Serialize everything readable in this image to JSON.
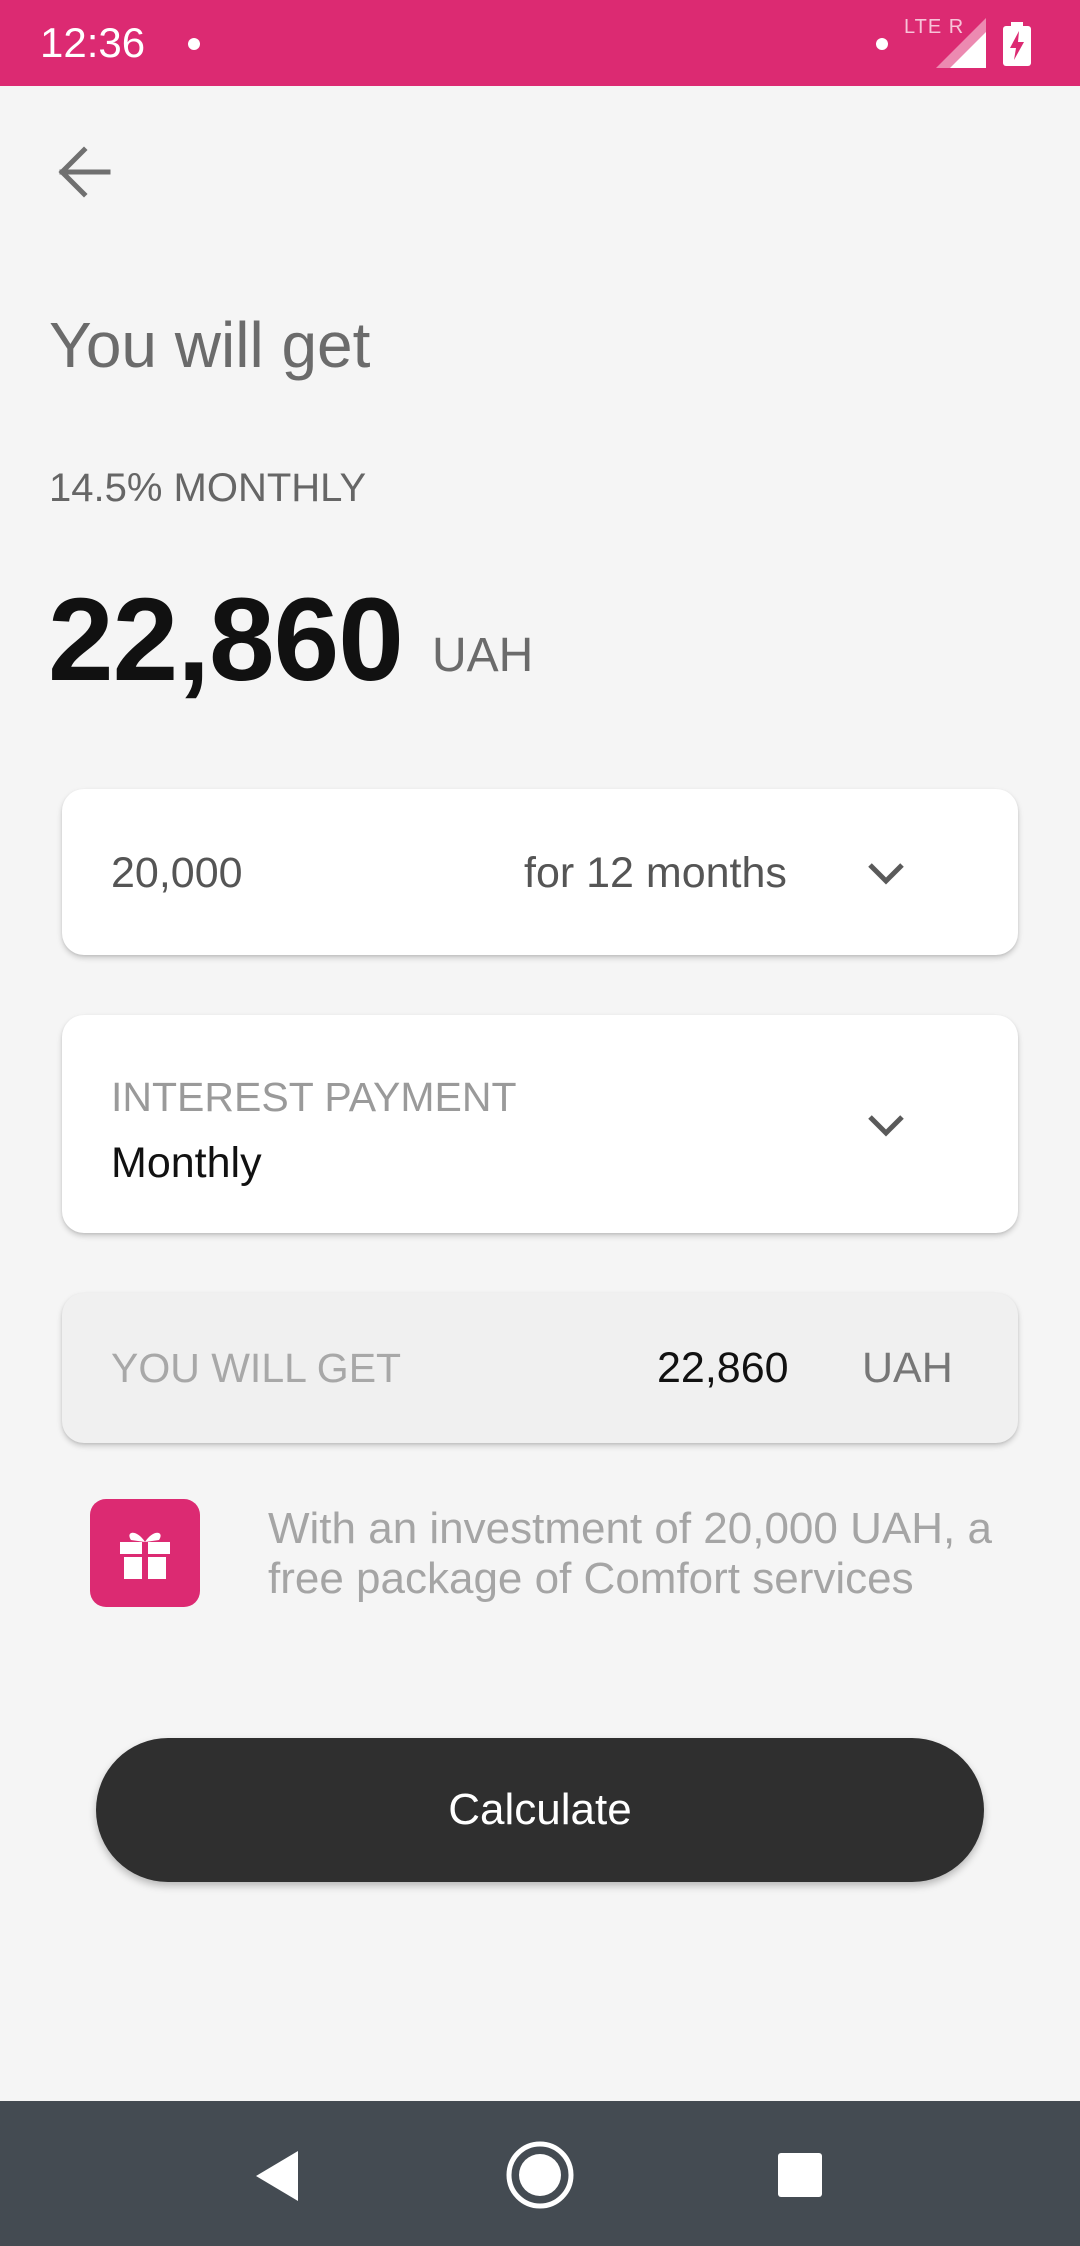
{
  "status_bar": {
    "time": "12:36",
    "network": "LTE R",
    "accent_color": "#dc2a72"
  },
  "header": {
    "back_icon": "arrow-left-icon"
  },
  "summary": {
    "title": "You will get",
    "rate": "14.5% MONTHLY",
    "amount": "22,860",
    "currency": "UAH"
  },
  "deposit_selector": {
    "amount": "20,000",
    "term": "for 12 months",
    "icon": "chevron-down-icon"
  },
  "interest_selector": {
    "label": "INTEREST PAYMENT",
    "value": "Monthly",
    "icon": "chevron-down-icon"
  },
  "total": {
    "label": "YOU WILL GET",
    "value": "22,860",
    "currency": "UAH"
  },
  "promo": {
    "icon": "gift-icon",
    "text": "With an investment of 20,000 UAH, a free package of Comfort services"
  },
  "actions": {
    "calculate_label": "Calculate",
    "button_color": "#2f2f2f"
  },
  "nav_bar": {
    "back_icon": "triangle-back-icon",
    "home_icon": "circle-home-icon",
    "recents_icon": "square-recents-icon"
  }
}
